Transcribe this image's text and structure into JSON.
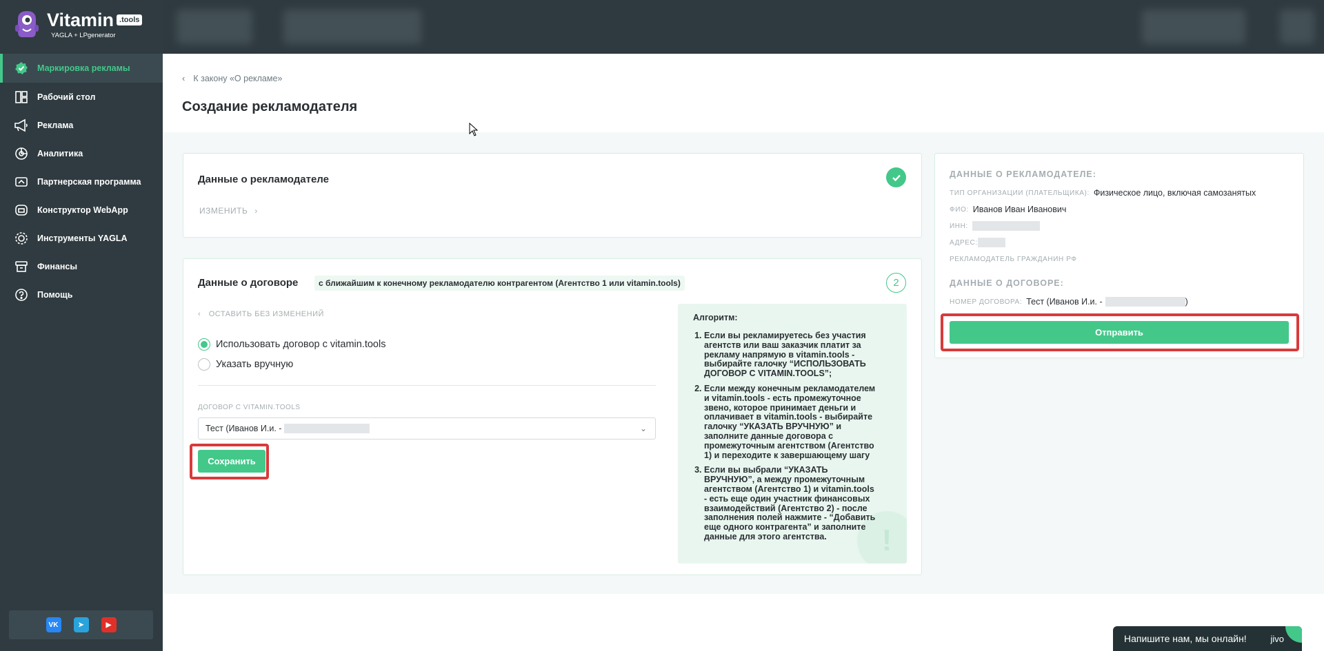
{
  "brand": {
    "name": "Vitamin",
    "badge": ".tools",
    "subtitle": "YAGLA + LPgenerator"
  },
  "sidebar": {
    "items": [
      {
        "label": "Маркировка рекламы",
        "icon": "badge-check-icon",
        "active": true
      },
      {
        "label": "Рабочий стол",
        "icon": "dashboard-icon"
      },
      {
        "label": "Реклама",
        "icon": "megaphone-icon"
      },
      {
        "label": "Аналитика",
        "icon": "analytics-icon"
      },
      {
        "label": "Партнерская программа",
        "icon": "partner-icon"
      },
      {
        "label": "Конструктор WebApp",
        "icon": "builder-icon"
      },
      {
        "label": "Инструменты YAGLA",
        "icon": "tools-icon"
      },
      {
        "label": "Финансы",
        "icon": "finance-icon"
      },
      {
        "label": "Помощь",
        "icon": "help-icon"
      }
    ],
    "social": [
      {
        "name": "vk-icon",
        "text": "VK"
      },
      {
        "name": "telegram-icon",
        "text": "➤"
      },
      {
        "name": "youtube-icon",
        "text": "▶"
      }
    ]
  },
  "header": {
    "back_label": "К закону «О рекламе»",
    "title": "Создание рекламодателя"
  },
  "advertiser_card": {
    "title": "Данные о рекламодателе",
    "edit_label": "ИЗМЕНИТЬ"
  },
  "contract_card": {
    "title": "Данные о договоре",
    "tag": "с ближайшим к конечному рекламодателю контрагентом (Агентство 1 или vitamin.tools)",
    "step": "2",
    "keep_label": "ОСТАВИТЬ БЕЗ ИЗМЕНЕНИЙ",
    "option_use": "Использовать договор с vitamin.tools",
    "option_manual": "Указать вручную",
    "field_label": "ДОГОВОР С VITAMIN.TOOLS",
    "select_value": "Тест (Иванов И.и. -",
    "save_label": "Сохранить"
  },
  "algorithm": {
    "title": "Алгоритм:",
    "steps": [
      "Если вы рекламируетесь без участия агентств или ваш заказчик платит за рекламу напрямую в vitamin.tools - выбирайте галочку “ИСПОЛЬЗОВАТЬ ДОГОВОР С VITAMIN.TOOLS”;",
      "Если между конечным рекламодателем и vitamin.tools - есть промежуточное звено, которое принимает деньги и оплачивает в vitamin.tools - выбирайте галочку “УКАЗАТЬ ВРУЧНУЮ” и заполните данные договора с промежуточным агентством (Агентство 1) и переходите к завершающему шагу",
      "Если вы выбрали “УКАЗАТЬ ВРУЧНУЮ”, а между промежуточным агентством (Агентство 1) и vitamin.tools - есть еще один участник финансовых взаимодействий (Агентство 2) - после заполнения полей нажмите - “Добавить еще одного контрагента” и заполните данные для этого агентства."
    ],
    "deco": "!"
  },
  "summary": {
    "advertiser_heading": "ДАННЫЕ О РЕКЛАМОДАТЕЛЕ:",
    "org_type_label": "ТИП ОРГАНИЗАЦИИ (ПЛАТЕЛЬЩИКА):",
    "org_type_value": "Физическое лицо, включая самозанятых",
    "fio_label": "ФИО:",
    "fio_value": "Иванов Иван Иванович",
    "inn_label": "ИНН:",
    "address_label": "АДРЕС:",
    "citizen_label": "РЕКЛАМОДАТЕЛЬ ГРАЖДАНИН РФ",
    "contract_heading": "ДАННЫЕ О ДОГОВОРЕ:",
    "contract_number_label": "НОМЕР ДОГОВОРА:",
    "contract_number_value": "Тест (Иванов И.и. -",
    "contract_number_tail": ")",
    "submit_label": "Отправить"
  },
  "chat": {
    "label": "Напишите нам, мы онлайн!",
    "brand": "jivo"
  },
  "colors": {
    "accent": "#43c88a",
    "sidebar": "#2f3b40",
    "highlight": "#d83a3a"
  }
}
